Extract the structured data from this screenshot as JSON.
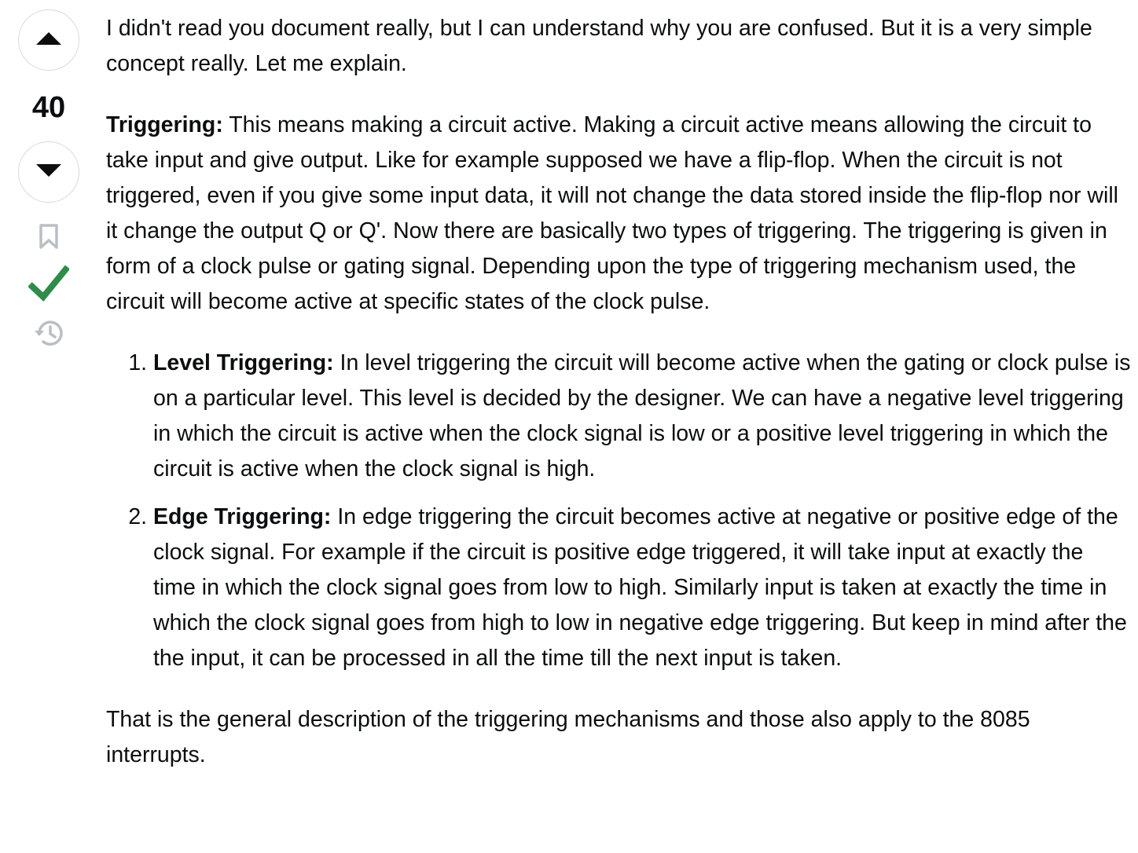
{
  "vote": {
    "count": "40",
    "upvote_icon": "triangle-up-icon",
    "downvote_icon": "triangle-down-icon",
    "bookmark_icon": "bookmark-icon",
    "accepted_icon": "checkmark-icon",
    "history_icon": "history-icon"
  },
  "colors": {
    "accepted": "#2f8b49",
    "icon_gray": "#babfc4",
    "text": "#0c0d0e",
    "vote_border": "#d6d9dc"
  },
  "answer": {
    "intro": "I didn't read you document really, but I can understand why you are confused. But it is a very simple concept really. Let me explain.",
    "triggering_label": "Triggering:",
    "triggering_text": " This means making a circuit active. Making a circuit active means allowing the circuit to take input and give output. Like for example supposed we have a flip-flop. When the circuit is not triggered, even if you give some input data, it will not change the data stored inside the flip-flop nor will it change the output Q or Q'. Now there are basically two types of triggering. The triggering is given in form of a clock pulse or gating signal. Depending upon the type of triggering mechanism used, the circuit will become active at specific states of the clock pulse.",
    "list": [
      {
        "label": "Level Triggering:",
        "text": " In level triggering the circuit will become active when the gating or clock pulse is on a particular level. This level is decided by the designer. We can have a negative level triggering in which the circuit is active when the clock signal is low or a positive level triggering in which the circuit is active when the clock signal is high."
      },
      {
        "label": "Edge Triggering:",
        "text": " In edge triggering the circuit becomes active at negative or positive edge of the clock signal. For example if the circuit is positive edge triggered, it will take input at exactly the time in which the clock signal goes from low to high. Similarly input is taken at exactly the time in which the clock signal goes from high to low in negative edge triggering. But keep in mind after the the input, it can be processed in all the time till the next input is taken."
      }
    ],
    "conclusion": "That is the general description of the triggering mechanisms and those also apply to the 8085 interrupts."
  }
}
